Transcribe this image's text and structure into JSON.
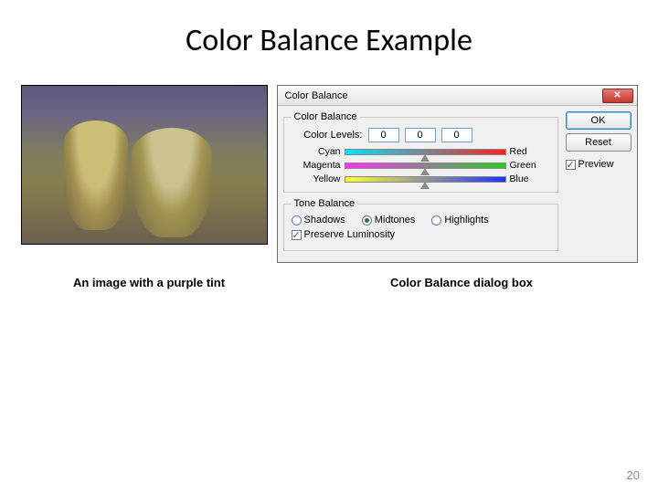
{
  "slide": {
    "title": "Color Balance Example",
    "caption_left": "An image with a purple tint",
    "caption_right": "Color Balance dialog box",
    "page_number": "20"
  },
  "dialog": {
    "title": "Color Balance",
    "close_glyph": "✕",
    "group_cb_legend": "Color Balance",
    "levels_label": "Color Levels:",
    "level_values": [
      "0",
      "0",
      "0"
    ],
    "sliders": [
      {
        "left": "Cyan",
        "right": "Red"
      },
      {
        "left": "Magenta",
        "right": "Green"
      },
      {
        "left": "Yellow",
        "right": "Blue"
      }
    ],
    "group_tone_legend": "Tone Balance",
    "tones": {
      "shadows": "Shadows",
      "midtones": "Midtones",
      "highlights": "Highlights",
      "selected": "midtones"
    },
    "preserve_label": "Preserve Luminosity",
    "buttons": {
      "ok": "OK",
      "reset": "Reset"
    },
    "preview_label": "Preview"
  }
}
